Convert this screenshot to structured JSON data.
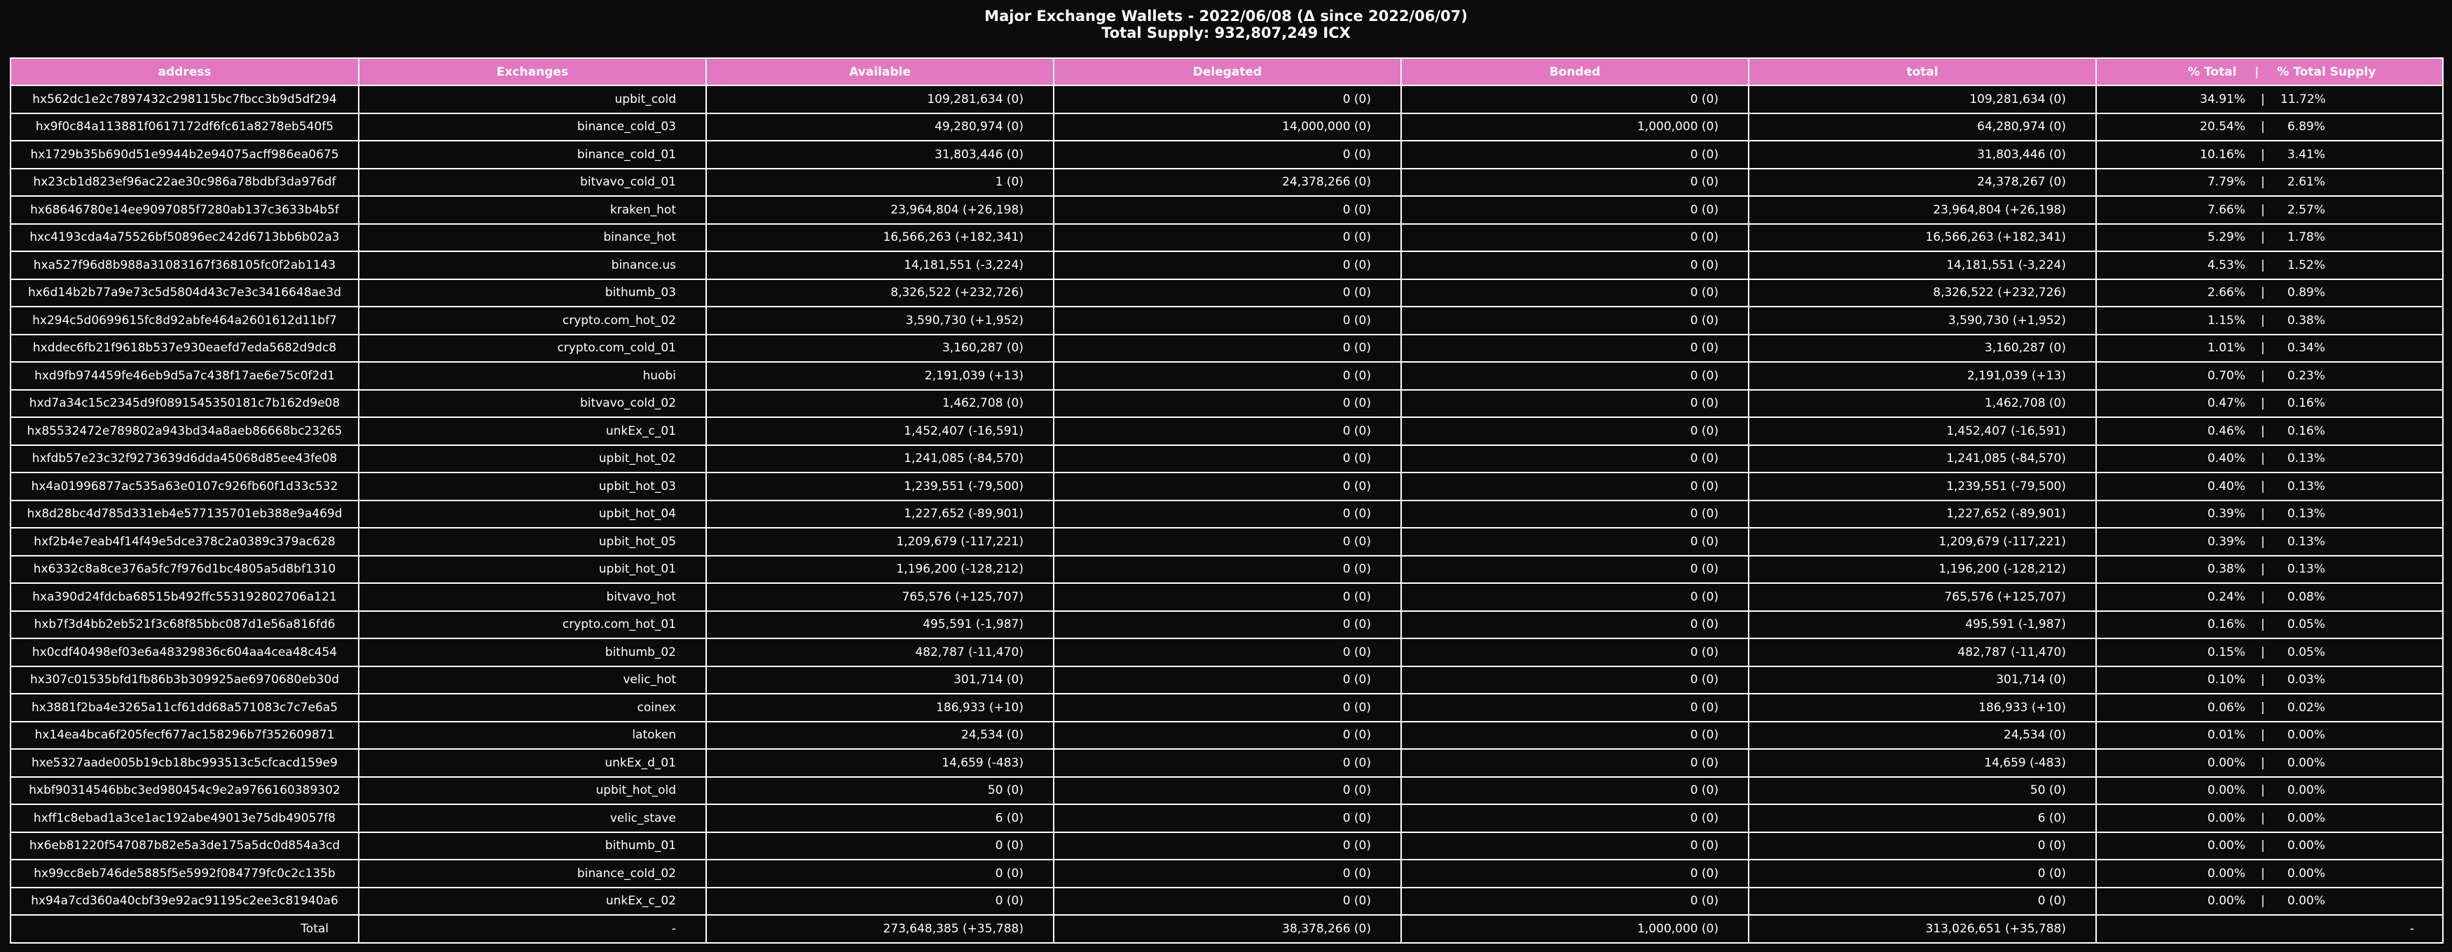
{
  "chart_data": {
    "type": "table",
    "title_line1": "Major Exchange Wallets - 2022/06/08 (Δ since 2022/06/07)",
    "title_line2": "Total Supply: 932,807,249 ICX",
    "columns": [
      "address",
      "Exchanges",
      "Available",
      "Delegated",
      "Bonded",
      "total",
      "% Total",
      "|",
      "% Total Supply"
    ],
    "rows": [
      {
        "address": "hx562dc1e2c7897432c298115bc7fbcc3b9d5df294",
        "exchange": "upbit_cold",
        "available": "109,281,634 (0)",
        "delegated": "0 (0)",
        "bonded": "0 (0)",
        "total": "109,281,634 (0)",
        "pct_total": "34.91%",
        "sep": "|",
        "pct_supply": "11.72%"
      },
      {
        "address": "hx9f0c84a113881f0617172df6fc61a8278eb540f5",
        "exchange": "binance_cold_03",
        "available": "49,280,974 (0)",
        "delegated": "14,000,000 (0)",
        "bonded": "1,000,000 (0)",
        "total": "64,280,974 (0)",
        "pct_total": "20.54%",
        "sep": "|",
        "pct_supply": "6.89%"
      },
      {
        "address": "hx1729b35b690d51e9944b2e94075acff986ea0675",
        "exchange": "binance_cold_01",
        "available": "31,803,446 (0)",
        "delegated": "0 (0)",
        "bonded": "0 (0)",
        "total": "31,803,446 (0)",
        "pct_total": "10.16%",
        "sep": "|",
        "pct_supply": "3.41%"
      },
      {
        "address": "hx23cb1d823ef96ac22ae30c986a78bdbf3da976df",
        "exchange": "bitvavo_cold_01",
        "available": "1 (0)",
        "delegated": "24,378,266 (0)",
        "bonded": "0 (0)",
        "total": "24,378,267 (0)",
        "pct_total": "7.79%",
        "sep": "|",
        "pct_supply": "2.61%"
      },
      {
        "address": "hx68646780e14ee9097085f7280ab137c3633b4b5f",
        "exchange": "kraken_hot",
        "available": "23,964,804 (+26,198)",
        "delegated": "0 (0)",
        "bonded": "0 (0)",
        "total": "23,964,804 (+26,198)",
        "pct_total": "7.66%",
        "sep": "|",
        "pct_supply": "2.57%"
      },
      {
        "address": "hxc4193cda4a75526bf50896ec242d6713bb6b02a3",
        "exchange": "binance_hot",
        "available": "16,566,263 (+182,341)",
        "delegated": "0 (0)",
        "bonded": "0 (0)",
        "total": "16,566,263 (+182,341)",
        "pct_total": "5.29%",
        "sep": "|",
        "pct_supply": "1.78%"
      },
      {
        "address": "hxa527f96d8b988a31083167f368105fc0f2ab1143",
        "exchange": "binance.us",
        "available": "14,181,551 (-3,224)",
        "delegated": "0 (0)",
        "bonded": "0 (0)",
        "total": "14,181,551 (-3,224)",
        "pct_total": "4.53%",
        "sep": "|",
        "pct_supply": "1.52%"
      },
      {
        "address": "hx6d14b2b77a9e73c5d5804d43c7e3c3416648ae3d",
        "exchange": "bithumb_03",
        "available": "8,326,522 (+232,726)",
        "delegated": "0 (0)",
        "bonded": "0 (0)",
        "total": "8,326,522 (+232,726)",
        "pct_total": "2.66%",
        "sep": "|",
        "pct_supply": "0.89%"
      },
      {
        "address": "hx294c5d0699615fc8d92abfe464a2601612d11bf7",
        "exchange": "crypto.com_hot_02",
        "available": "3,590,730 (+1,952)",
        "delegated": "0 (0)",
        "bonded": "0 (0)",
        "total": "3,590,730 (+1,952)",
        "pct_total": "1.15%",
        "sep": "|",
        "pct_supply": "0.38%"
      },
      {
        "address": "hxddec6fb21f9618b537e930eaefd7eda5682d9dc8",
        "exchange": "crypto.com_cold_01",
        "available": "3,160,287 (0)",
        "delegated": "0 (0)",
        "bonded": "0 (0)",
        "total": "3,160,287 (0)",
        "pct_total": "1.01%",
        "sep": "|",
        "pct_supply": "0.34%"
      },
      {
        "address": "hxd9fb974459fe46eb9d5a7c438f17ae6e75c0f2d1",
        "exchange": "huobi",
        "available": "2,191,039 (+13)",
        "delegated": "0 (0)",
        "bonded": "0 (0)",
        "total": "2,191,039 (+13)",
        "pct_total": "0.70%",
        "sep": "|",
        "pct_supply": "0.23%"
      },
      {
        "address": "hxd7a34c15c2345d9f0891545350181c7b162d9e08",
        "exchange": "bitvavo_cold_02",
        "available": "1,462,708 (0)",
        "delegated": "0 (0)",
        "bonded": "0 (0)",
        "total": "1,462,708 (0)",
        "pct_total": "0.47%",
        "sep": "|",
        "pct_supply": "0.16%"
      },
      {
        "address": "hx85532472e789802a943bd34a8aeb86668bc23265",
        "exchange": "unkEx_c_01",
        "available": "1,452,407 (-16,591)",
        "delegated": "0 (0)",
        "bonded": "0 (0)",
        "total": "1,452,407 (-16,591)",
        "pct_total": "0.46%",
        "sep": "|",
        "pct_supply": "0.16%"
      },
      {
        "address": "hxfdb57e23c32f9273639d6dda45068d85ee43fe08",
        "exchange": "upbit_hot_02",
        "available": "1,241,085 (-84,570)",
        "delegated": "0 (0)",
        "bonded": "0 (0)",
        "total": "1,241,085 (-84,570)",
        "pct_total": "0.40%",
        "sep": "|",
        "pct_supply": "0.13%"
      },
      {
        "address": "hx4a01996877ac535a63e0107c926fb60f1d33c532",
        "exchange": "upbit_hot_03",
        "available": "1,239,551 (-79,500)",
        "delegated": "0 (0)",
        "bonded": "0 (0)",
        "total": "1,239,551 (-79,500)",
        "pct_total": "0.40%",
        "sep": "|",
        "pct_supply": "0.13%"
      },
      {
        "address": "hx8d28bc4d785d331eb4e577135701eb388e9a469d",
        "exchange": "upbit_hot_04",
        "available": "1,227,652 (-89,901)",
        "delegated": "0 (0)",
        "bonded": "0 (0)",
        "total": "1,227,652 (-89,901)",
        "pct_total": "0.39%",
        "sep": "|",
        "pct_supply": "0.13%"
      },
      {
        "address": "hxf2b4e7eab4f14f49e5dce378c2a0389c379ac628",
        "exchange": "upbit_hot_05",
        "available": "1,209,679 (-117,221)",
        "delegated": "0 (0)",
        "bonded": "0 (0)",
        "total": "1,209,679 (-117,221)",
        "pct_total": "0.39%",
        "sep": "|",
        "pct_supply": "0.13%"
      },
      {
        "address": "hx6332c8a8ce376a5fc7f976d1bc4805a5d8bf1310",
        "exchange": "upbit_hot_01",
        "available": "1,196,200 (-128,212)",
        "delegated": "0 (0)",
        "bonded": "0 (0)",
        "total": "1,196,200 (-128,212)",
        "pct_total": "0.38%",
        "sep": "|",
        "pct_supply": "0.13%"
      },
      {
        "address": "hxa390d24fdcba68515b492ffc553192802706a121",
        "exchange": "bitvavo_hot",
        "available": "765,576 (+125,707)",
        "delegated": "0 (0)",
        "bonded": "0 (0)",
        "total": "765,576 (+125,707)",
        "pct_total": "0.24%",
        "sep": "|",
        "pct_supply": "0.08%"
      },
      {
        "address": "hxb7f3d4bb2eb521f3c68f85bbc087d1e56a816fd6",
        "exchange": "crypto.com_hot_01",
        "available": "495,591 (-1,987)",
        "delegated": "0 (0)",
        "bonded": "0 (0)",
        "total": "495,591 (-1,987)",
        "pct_total": "0.16%",
        "sep": "|",
        "pct_supply": "0.05%"
      },
      {
        "address": "hx0cdf40498ef03e6a48329836c604aa4cea48c454",
        "exchange": "bithumb_02",
        "available": "482,787 (-11,470)",
        "delegated": "0 (0)",
        "bonded": "0 (0)",
        "total": "482,787 (-11,470)",
        "pct_total": "0.15%",
        "sep": "|",
        "pct_supply": "0.05%"
      },
      {
        "address": "hx307c01535bfd1fb86b3b309925ae6970680eb30d",
        "exchange": "velic_hot",
        "available": "301,714 (0)",
        "delegated": "0 (0)",
        "bonded": "0 (0)",
        "total": "301,714 (0)",
        "pct_total": "0.10%",
        "sep": "|",
        "pct_supply": "0.03%"
      },
      {
        "address": "hx3881f2ba4e3265a11cf61dd68a571083c7c7e6a5",
        "exchange": "coinex",
        "available": "186,933 (+10)",
        "delegated": "0 (0)",
        "bonded": "0 (0)",
        "total": "186,933 (+10)",
        "pct_total": "0.06%",
        "sep": "|",
        "pct_supply": "0.02%"
      },
      {
        "address": "hx14ea4bca6f205fecf677ac158296b7f352609871",
        "exchange": "latoken",
        "available": "24,534 (0)",
        "delegated": "0 (0)",
        "bonded": "0 (0)",
        "total": "24,534 (0)",
        "pct_total": "0.01%",
        "sep": "|",
        "pct_supply": "0.00%"
      },
      {
        "address": "hxe5327aade005b19cb18bc993513c5cfcacd159e9",
        "exchange": "unkEx_d_01",
        "available": "14,659 (-483)",
        "delegated": "0 (0)",
        "bonded": "0 (0)",
        "total": "14,659 (-483)",
        "pct_total": "0.00%",
        "sep": "|",
        "pct_supply": "0.00%"
      },
      {
        "address": "hxbf90314546bbc3ed980454c9e2a9766160389302",
        "exchange": "upbit_hot_old",
        "available": "50 (0)",
        "delegated": "0 (0)",
        "bonded": "0 (0)",
        "total": "50 (0)",
        "pct_total": "0.00%",
        "sep": "|",
        "pct_supply": "0.00%"
      },
      {
        "address": "hxff1c8ebad1a3ce1ac192abe49013e75db49057f8",
        "exchange": "velic_stave",
        "available": "6 (0)",
        "delegated": "0 (0)",
        "bonded": "0 (0)",
        "total": "6 (0)",
        "pct_total": "0.00%",
        "sep": "|",
        "pct_supply": "0.00%"
      },
      {
        "address": "hx6eb81220f547087b82e5a3de175a5dc0d854a3cd",
        "exchange": "bithumb_01",
        "available": "0 (0)",
        "delegated": "0 (0)",
        "bonded": "0 (0)",
        "total": "0 (0)",
        "pct_total": "0.00%",
        "sep": "|",
        "pct_supply": "0.00%"
      },
      {
        "address": "hx99cc8eb746de5885f5e5992f084779fc0c2c135b",
        "exchange": "binance_cold_02",
        "available": "0 (0)",
        "delegated": "0 (0)",
        "bonded": "0 (0)",
        "total": "0 (0)",
        "pct_total": "0.00%",
        "sep": "|",
        "pct_supply": "0.00%"
      },
      {
        "address": "hx94a7cd360a40cbf39e92ac91195c2ee3c81940a6",
        "exchange": "unkEx_c_02",
        "available": "0 (0)",
        "delegated": "0 (0)",
        "bonded": "0 (0)",
        "total": "0 (0)",
        "pct_total": "0.00%",
        "sep": "|",
        "pct_supply": "0.00%"
      }
    ],
    "totals": {
      "address": "Total",
      "exchange": "-",
      "available": "273,648,385 (+35,788)",
      "delegated": "38,378,266 (0)",
      "bonded": "1,000,000 (0)",
      "total": "313,026,651 (+35,788)",
      "pct": "-"
    },
    "colors": {
      "background": "#0b0b0b",
      "header_fill": "#e377c2",
      "grid": "#ffffff",
      "text": "#ffffff"
    }
  }
}
